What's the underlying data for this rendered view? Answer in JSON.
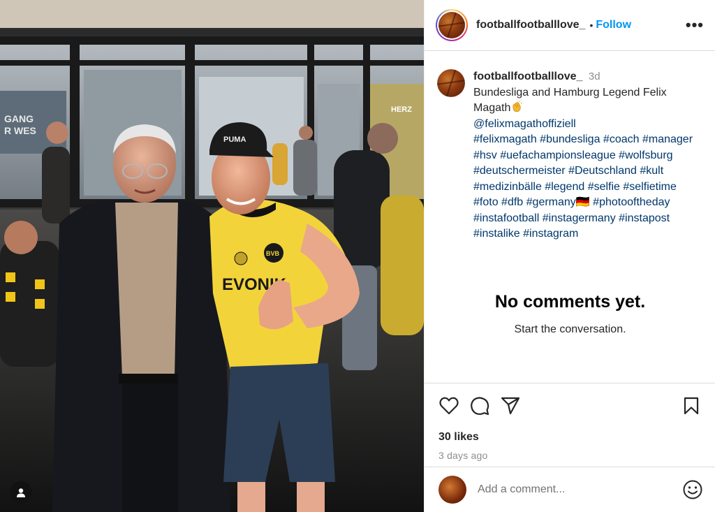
{
  "post": {
    "username": "footballfootballlove_",
    "follow_label": "Follow",
    "separator": "•",
    "more_label": "•••",
    "caption": {
      "username": "footballfootballlove_",
      "time_ago": "3d",
      "text": "Bundesliga and Hamburg Legend Felix Magath",
      "emoji_icon": "clapping-hands-icon",
      "mention": "@felixmagathoffiziell",
      "hashtags": [
        "#felixmagath",
        "#bundesliga",
        "#coach",
        "#manager",
        "#hsv",
        "#uefachampionsleague",
        "#wolfsburg",
        "#deutschermeister",
        "#Deutschland",
        "#kult",
        "#medizinbälle",
        "#legend",
        "#selfie",
        "#selfietime",
        "#foto",
        "#dfb",
        "#germany🇩🇪",
        "#photooftheday",
        "#instafootball",
        "#instagermany",
        "#instapost",
        "#instalike",
        "#instagram"
      ]
    },
    "comments": {
      "empty_title": "No comments yet.",
      "empty_subtitle": "Start the conversation."
    },
    "actions": {
      "like_icon": "heart-icon",
      "comment_icon": "comment-bubble-icon",
      "share_icon": "paper-plane-icon",
      "save_icon": "bookmark-icon"
    },
    "likes_label": "30 likes",
    "date_label": "3 days ago",
    "add_comment": {
      "placeholder": "Add a comment...",
      "emoji_icon": "smiley-icon"
    },
    "photo": {
      "tag_icon": "user-tag-icon",
      "sign_text_1": "GANG",
      "sign_text_2": "R WES",
      "sign_text_3": "HERZ",
      "shirt_text": "EVONIK",
      "cap_text": "PUMA",
      "badge_text": "BVB"
    }
  },
  "colors": {
    "accent": "#0095f6",
    "hashtag": "#00376b",
    "muted": "#8e8e8e",
    "border": "#dbdbdb",
    "jersey_yellow": "#f2d43a"
  }
}
